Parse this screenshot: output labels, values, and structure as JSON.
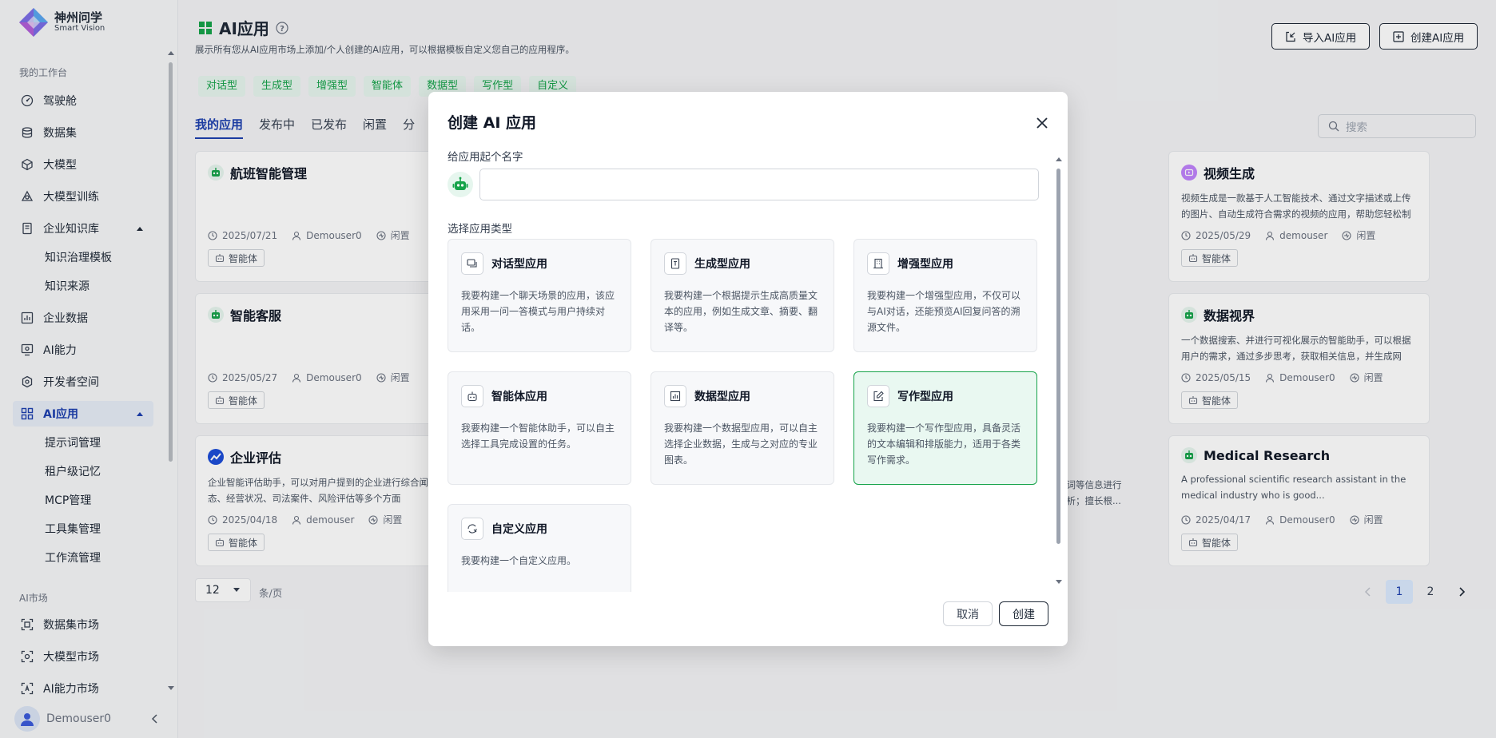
{
  "brand": {
    "title": "神州问学",
    "subtitle": "Smart Vision"
  },
  "sidebar": {
    "section_workspace": "我的工作台",
    "items": [
      {
        "label": "驾驶舱",
        "icon": "dashboard-icon"
      },
      {
        "label": "数据集",
        "icon": "database-icon"
      },
      {
        "label": "大模型",
        "icon": "cube-icon"
      },
      {
        "label": "大模型训练",
        "icon": "training-icon"
      },
      {
        "label": "企业知识库",
        "icon": "book-icon"
      },
      {
        "label": "知识治理模板"
      },
      {
        "label": "知识来源"
      },
      {
        "label": "企业数据",
        "icon": "chart-icon"
      },
      {
        "label": "AI能力",
        "icon": "ai-icon"
      },
      {
        "label": "开发者空间",
        "icon": "dev-icon"
      },
      {
        "label": "AI应用",
        "icon": "grid-icon"
      },
      {
        "label": "提示词管理"
      },
      {
        "label": "租户级记忆"
      },
      {
        "label": "MCP管理"
      },
      {
        "label": "工具集管理"
      },
      {
        "label": "工作流管理"
      }
    ],
    "section_market": "AI市场",
    "market_items": [
      {
        "label": "数据集市场"
      },
      {
        "label": "大模型市场"
      },
      {
        "label": "AI能力市场"
      }
    ],
    "user": "Demouser0"
  },
  "page": {
    "title": "AI应用",
    "description": "展示所有您从AI应用市场上添加/个人创建的AI应用，可以根据模板自定义您自己的应用程序。",
    "import_button": "导入AI应用",
    "create_button": "创建AI应用",
    "filters": [
      "对话型",
      "生成型",
      "增强型",
      "智能体",
      "数据型",
      "写作型",
      "自定义"
    ],
    "tabs": [
      "我的应用",
      "发布中",
      "已发布",
      "闲置",
      "分"
    ],
    "search_placeholder": "搜索"
  },
  "cards": [
    {
      "name": "航班智能管理",
      "desc": "",
      "date": "2025/07/21",
      "user": "Demouser0",
      "status": "闲置",
      "tag": "智能体"
    },
    {
      "name": "智能客服",
      "desc": "",
      "date": "2025/05/27",
      "user": "Demouser0",
      "status": "闲置",
      "tag": "智能体"
    },
    {
      "name": "企业评估",
      "desc": "企业智能评估助手，可以对用户提到的企业进行综合闻动态、经营状况、司法案件、风险评估等多个方面",
      "date": "2025/04/18",
      "user": "demouser",
      "status": "闲置",
      "tag": "智能体"
    },
    {
      "name": "视频生成",
      "desc": "视频生成是一款基于人工智能技术、通过文字描述或上传的图片、自动生成符合需求的视频的应用，帮助您轻松制作专业的视频。 ...",
      "date": "2025/05/29",
      "user": "demouser",
      "status": "闲置",
      "tag": "智能体"
    },
    {
      "name": "数据视界",
      "desc": "一个数据搜索、并进行可视化展示的智能助手，可以根据用户的需求，通过多步思考，获取相关信息，并生成网页，供用户直观查...",
      "date": "2025/05/15",
      "user": "Demouser0",
      "status": "闲置",
      "tag": "智能体"
    },
    {
      "name": "Medical Research",
      "desc": "A professional scientific research assistant in the medical industry who is good...",
      "date": "2025/04/17",
      "user": "Demouser0",
      "status": "闲置",
      "tag": "智能体"
    }
  ],
  "partial_text": {
    "line1": "键词等信息进行",
    "line2": "分析；擅长根..."
  },
  "pagination": {
    "page_size": "12",
    "unit": "条/页",
    "pages": [
      "1",
      "2"
    ]
  },
  "modal": {
    "title": "创建 AI 应用",
    "name_label": "给应用起个名字",
    "name_value": "",
    "type_label": "选择应用类型",
    "types": [
      {
        "title": "对话型应用",
        "desc": "我要构建一个聊天场景的应用，该应用采用一问一答模式与用户持续对话。"
      },
      {
        "title": "生成型应用",
        "desc": "我要构建一个根据提示生成高质量文本的应用，例如生成文章、摘要、翻译等。"
      },
      {
        "title": "增强型应用",
        "desc": "我要构建一个增强型应用，不仅可以与AI对话，还能预览AI回复问答的溯源文件。"
      },
      {
        "title": "智能体应用",
        "desc": "我要构建一个智能体助手，可以自主选择工具完成设置的任务。"
      },
      {
        "title": "数据型应用",
        "desc": "我要构建一个数据型应用，可以自主选择企业数据，生成与之对应的专业图表。"
      },
      {
        "title": "写作型应用",
        "desc": "我要构建一个写作型应用，具备灵活的文本编辑和排版能力，适用于各类写作需求。"
      },
      {
        "title": "自定义应用",
        "desc": "我要构建一个自定义应用。"
      }
    ],
    "selected": "写作型应用",
    "cancel": "取消",
    "create": "创建"
  },
  "colors": {
    "accent_green": "#16a34a",
    "accent_blue": "#1e40af"
  }
}
